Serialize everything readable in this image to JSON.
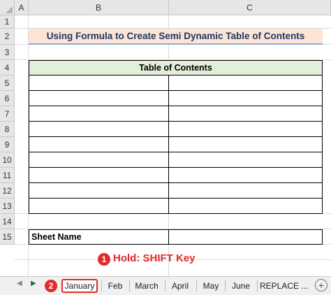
{
  "columns": [
    "A",
    "B",
    "C"
  ],
  "rows": [
    "1",
    "2",
    "3",
    "4",
    "5",
    "6",
    "7",
    "8",
    "9",
    "10",
    "11",
    "12",
    "13",
    "14",
    "15"
  ],
  "title": "Using Formula to Create Semi Dynamic Table of Contents",
  "toc_header": "Table of Contents",
  "sheet_name_label": "Sheet Name",
  "annotation": {
    "badge1": "1",
    "note": "Hold: SHIFT Key",
    "badge2": "2"
  },
  "tabs": [
    "January",
    "Feb",
    "March",
    "April",
    "May",
    "June",
    "REPLACE",
    "..."
  ],
  "selected_tab": "January",
  "icons": {
    "prev": "prev-sheet-icon",
    "next": "next-sheet-icon",
    "add": "add-sheet-icon"
  },
  "colors": {
    "title_fill": "#fce4d6",
    "toc_fill": "#e2efda",
    "accent": "#e02b2b",
    "title_text": "#1f3864"
  }
}
